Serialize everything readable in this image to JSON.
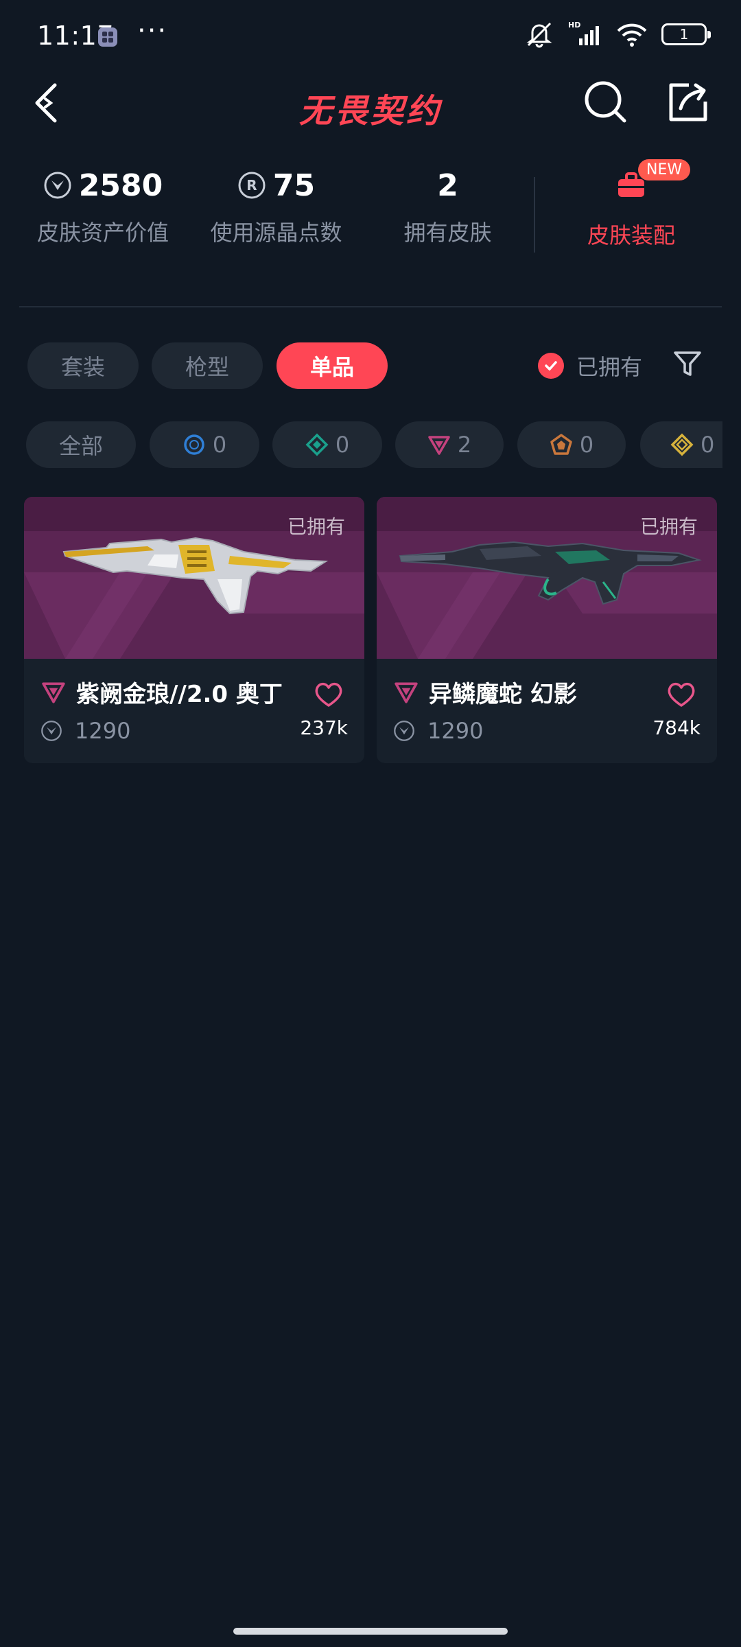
{
  "status_bar": {
    "time": "11:17",
    "dots": "···",
    "battery": "1",
    "network": "HD"
  },
  "header": {
    "logo_text": "无畏契约"
  },
  "stats": {
    "asset_value": "2580",
    "asset_value_label": "皮肤资产价值",
    "radianite_points": "75",
    "radianite_points_label": "使用源晶点数",
    "owned_skins": "2",
    "owned_skins_label": "拥有皮肤",
    "equip_label": "皮肤装配",
    "new_badge": "NEW"
  },
  "tabs": [
    {
      "label": "套装",
      "active": false
    },
    {
      "label": "枪型",
      "active": false
    },
    {
      "label": "单品",
      "active": true
    }
  ],
  "owned_filter": {
    "label": "已拥有",
    "checked": true
  },
  "tier_chips": [
    {
      "label": "全部",
      "icon": "none"
    },
    {
      "count": "0",
      "icon": "select-tier-icon",
      "color": "#2f7fd6"
    },
    {
      "count": "0",
      "icon": "deluxe-tier-icon",
      "color": "#1aa08c"
    },
    {
      "count": "2",
      "icon": "premium-tier-icon",
      "color": "#c4427e"
    },
    {
      "count": "0",
      "icon": "exclusive-tier-icon",
      "color": "#c9773c"
    },
    {
      "count": "0",
      "icon": "ultra-tier-icon",
      "color": "#d6b23c"
    }
  ],
  "cards": [
    {
      "owned_label": "已拥有",
      "name": "紫阙金琅//2.0 奥丁",
      "price": "1290",
      "likes": "237k",
      "tier_icon": "premium-tier-icon"
    },
    {
      "owned_label": "已拥有",
      "name": "异鳞魔蛇 幻影",
      "price": "1290",
      "likes": "784k",
      "tier_icon": "premium-tier-icon"
    }
  ],
  "colors": {
    "accent": "#ff4655",
    "background": "#101823",
    "card": "#17202b",
    "chip": "#1f2833"
  }
}
